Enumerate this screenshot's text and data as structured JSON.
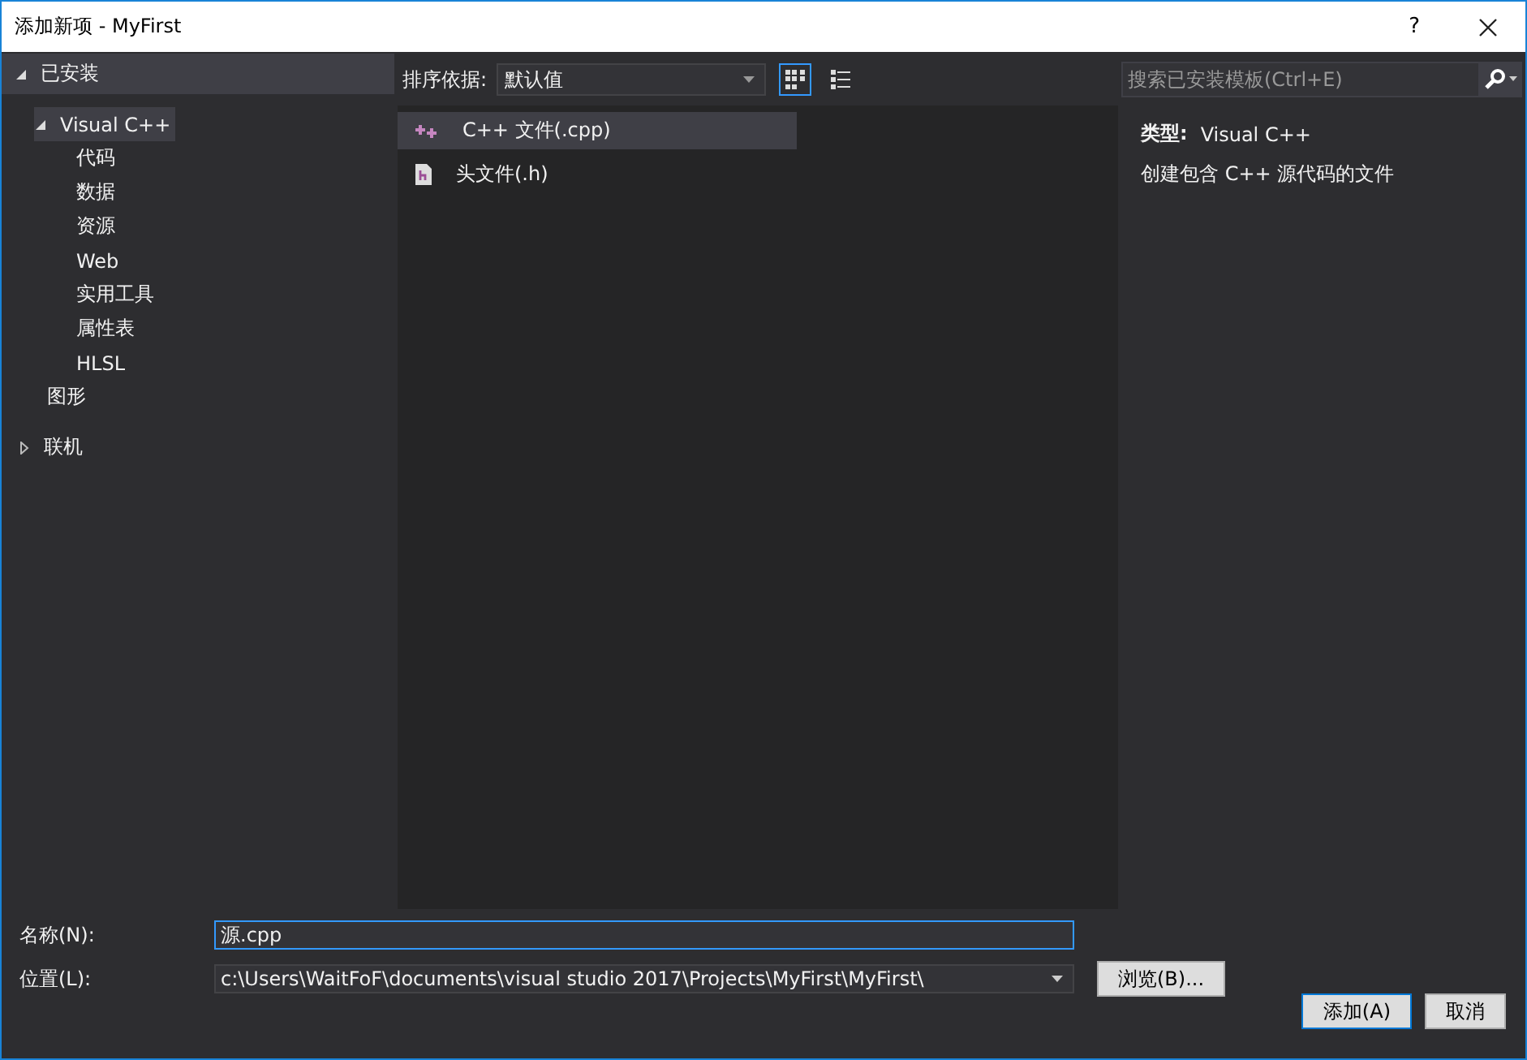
{
  "window": {
    "title": "添加新项 - MyFirst",
    "help": "?"
  },
  "sidebar": {
    "installed": {
      "label": "已安装",
      "expanded": true,
      "children": [
        {
          "label": "Visual C++",
          "expanded": true,
          "selected": true,
          "children": [
            {
              "label": "代码",
              "selected": false
            },
            {
              "label": "数据",
              "selected": false
            },
            {
              "label": "资源",
              "selected": false
            },
            {
              "label": "Web",
              "selected": false
            },
            {
              "label": "实用工具",
              "selected": false
            },
            {
              "label": "属性表",
              "selected": false
            },
            {
              "label": "HLSL",
              "selected": false
            }
          ]
        },
        {
          "label": "图形",
          "selected": false
        }
      ]
    },
    "online": {
      "label": "联机",
      "expanded": false,
      "selected": false
    }
  },
  "toolbar": {
    "sort_label": "排序依据:",
    "sort_value": "默认值",
    "views": [
      {
        "kind": "grid",
        "selected": true
      },
      {
        "kind": "list",
        "selected": false
      }
    ]
  },
  "templates": [
    {
      "kind": "cpp",
      "label": "C++ 文件(.cpp)",
      "selected": true
    },
    {
      "kind": "header",
      "label": "头文件(.h)",
      "selected": false
    }
  ],
  "search": {
    "placeholder": "搜索已安装模板(Ctrl+E)"
  },
  "details": {
    "type_label": "类型:",
    "type_value": "Visual C++",
    "description": "创建包含 C++ 源代码的文件"
  },
  "form": {
    "name_label": "名称(N):",
    "name_value": "源.cpp",
    "location_label": "位置(L):",
    "location_value": "c:\\Users\\WaitFoF\\documents\\visual studio 2017\\Projects\\MyFirst\\MyFirst\\",
    "browse": "浏览(B)..."
  },
  "buttons": [
    {
      "label": "添加(A)",
      "default": true
    },
    {
      "label": "取消",
      "default": false
    }
  ]
}
